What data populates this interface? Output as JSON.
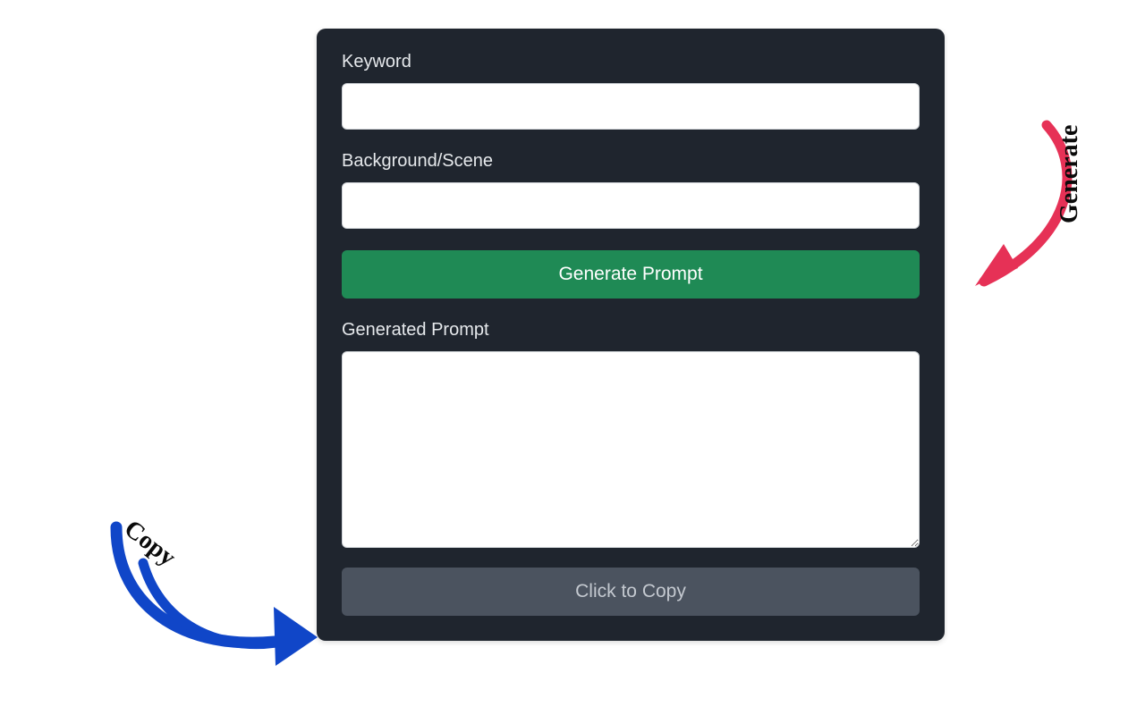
{
  "form": {
    "keyword_label": "Keyword",
    "keyword_value": "",
    "background_label": "Background/Scene",
    "background_value": "",
    "generate_button": "Generate Prompt",
    "output_label": "Generated Prompt",
    "output_value": "",
    "copy_button": "Click to Copy"
  },
  "annotations": {
    "generate": "Generate",
    "copy": "Copy"
  },
  "colors": {
    "panel_bg": "#1f252e",
    "generate_btn": "#1f8a55",
    "copy_btn": "#4b535f",
    "arrow_generate": "#e63156",
    "arrow_copy": "#1046c8"
  }
}
